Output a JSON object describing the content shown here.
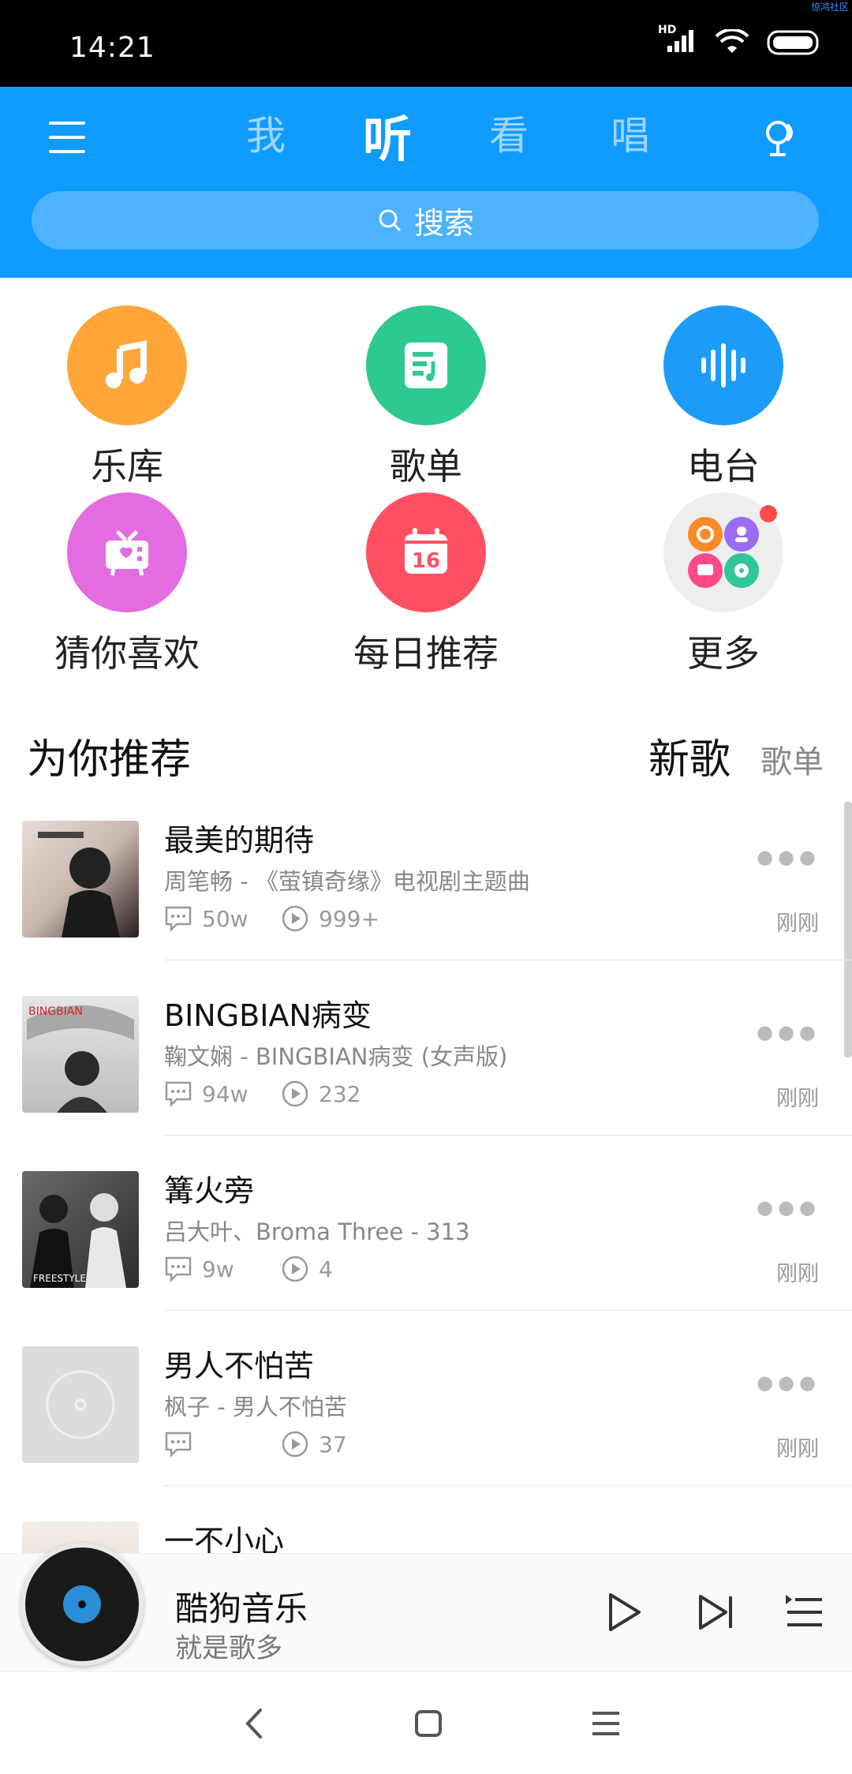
{
  "status_bar": {
    "time": "14:21",
    "hd": "HD",
    "watermark": "惊鸿社区"
  },
  "header": {
    "tabs": [
      "我",
      "听",
      "看",
      "唱"
    ],
    "active_tab": "听",
    "search_placeholder": "搜索",
    "accent_color": "#0f9bff"
  },
  "categories": [
    {
      "label": "乐库",
      "icon": "music-note-icon",
      "color": "#ffa63a"
    },
    {
      "label": "歌单",
      "icon": "playlist-icon",
      "color": "#2ec990"
    },
    {
      "label": "电台",
      "icon": "soundwave-icon",
      "color": "#1c9cf8"
    },
    {
      "label": "猜你喜欢",
      "icon": "heart-radio-icon",
      "color": "#e36ce0"
    },
    {
      "label": "每日推荐",
      "icon": "calendar-icon",
      "color": "#ff5063",
      "calendar_day": "16"
    },
    {
      "label": "更多",
      "icon": "more-apps-icon",
      "color": "#eeeeee"
    }
  ],
  "section": {
    "title": "为你推荐",
    "tab_new": "新歌",
    "tab_playlist": "歌单"
  },
  "songs": [
    {
      "title": "最美的期待",
      "subtitle": "周笔畅 - 《萤镇奇缘》电视剧主题曲",
      "comments": "50w",
      "plays": "999+",
      "time": "刚刚"
    },
    {
      "title": "BINGBIAN病变",
      "subtitle": "鞠文娴 - BINGBIAN病变 (女声版)",
      "comments": "94w",
      "plays": "232",
      "time": "刚刚"
    },
    {
      "title": "篝火旁",
      "subtitle": "吕大叶、Broma Three - 313",
      "comments": "9w",
      "plays": "4",
      "time": "刚刚"
    },
    {
      "title": "男人不怕苦",
      "subtitle": "枫子 - 男人不怕苦",
      "comments": "",
      "plays": "37",
      "time": "刚刚"
    },
    {
      "title": "一不小心",
      "subtitle": "",
      "comments": "",
      "plays": "",
      "time": ""
    }
  ],
  "player": {
    "name": "酷狗音乐",
    "slogan": "就是歌多"
  }
}
